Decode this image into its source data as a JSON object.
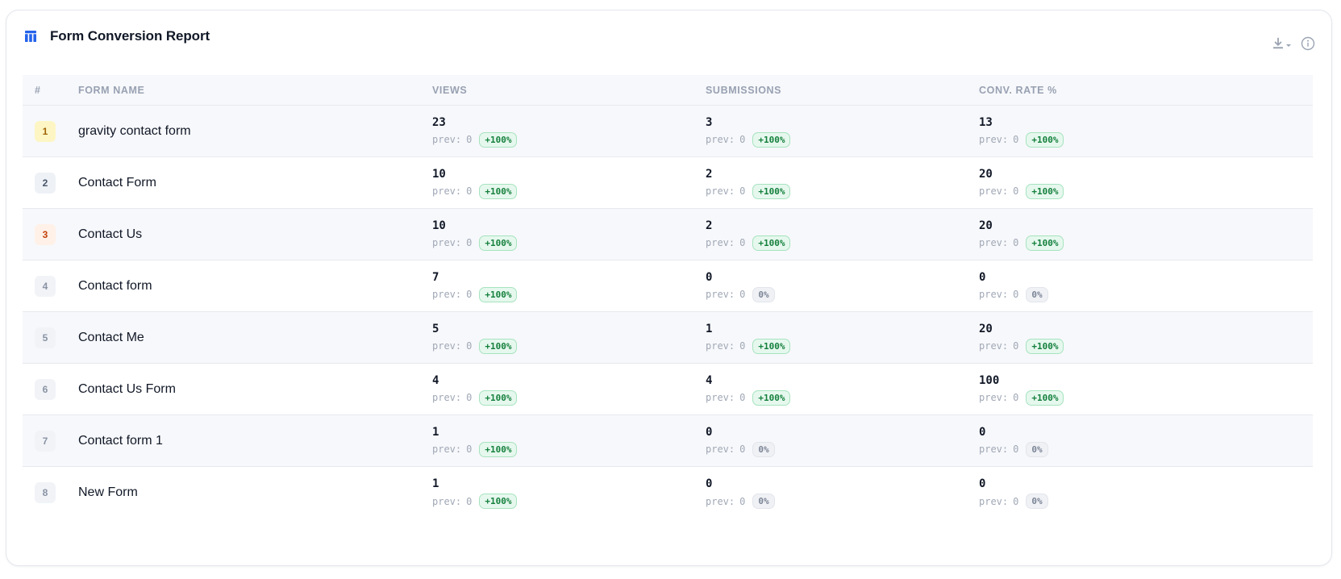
{
  "card": {
    "title": "Form Conversion Report",
    "title_icon": "table-icon",
    "actions": [
      {
        "name": "download-icon"
      },
      {
        "name": "info-icon"
      }
    ]
  },
  "colors": {
    "accent": "#2563eb",
    "positive_badge_bg": "#e6f8ee",
    "positive_badge_text": "#15803d",
    "neutral_badge_bg": "#eff1f5"
  },
  "table": {
    "headers": {
      "rank": "#",
      "name": "FORM NAME",
      "views": "VIEWS",
      "submissions": "SUBMISSIONS",
      "rate": "CONV. RATE %"
    },
    "prev_label": "prev:",
    "rows": [
      {
        "rank": "1",
        "name": "gravity contact form",
        "views": {
          "value": "23",
          "prev": "0",
          "change": "+100%",
          "trend": "positive"
        },
        "submissions": {
          "value": "3",
          "prev": "0",
          "change": "+100%",
          "trend": "positive"
        },
        "rate": {
          "value": "13",
          "prev": "0",
          "change": "+100%",
          "trend": "positive"
        }
      },
      {
        "rank": "2",
        "name": "Contact Form",
        "views": {
          "value": "10",
          "prev": "0",
          "change": "+100%",
          "trend": "positive"
        },
        "submissions": {
          "value": "2",
          "prev": "0",
          "change": "+100%",
          "trend": "positive"
        },
        "rate": {
          "value": "20",
          "prev": "0",
          "change": "+100%",
          "trend": "positive"
        }
      },
      {
        "rank": "3",
        "name": "Contact Us",
        "views": {
          "value": "10",
          "prev": "0",
          "change": "+100%",
          "trend": "positive"
        },
        "submissions": {
          "value": "2",
          "prev": "0",
          "change": "+100%",
          "trend": "positive"
        },
        "rate": {
          "value": "20",
          "prev": "0",
          "change": "+100%",
          "trend": "positive"
        }
      },
      {
        "rank": "4",
        "name": "Contact form",
        "views": {
          "value": "7",
          "prev": "0",
          "change": "+100%",
          "trend": "positive"
        },
        "submissions": {
          "value": "0",
          "prev": "0",
          "change": "0%",
          "trend": "neutral"
        },
        "rate": {
          "value": "0",
          "prev": "0",
          "change": "0%",
          "trend": "neutral"
        }
      },
      {
        "rank": "5",
        "name": "Contact Me",
        "views": {
          "value": "5",
          "prev": "0",
          "change": "+100%",
          "trend": "positive"
        },
        "submissions": {
          "value": "1",
          "prev": "0",
          "change": "+100%",
          "trend": "positive"
        },
        "rate": {
          "value": "20",
          "prev": "0",
          "change": "+100%",
          "trend": "positive"
        }
      },
      {
        "rank": "6",
        "name": "Contact Us Form",
        "views": {
          "value": "4",
          "prev": "0",
          "change": "+100%",
          "trend": "positive"
        },
        "submissions": {
          "value": "4",
          "prev": "0",
          "change": "+100%",
          "trend": "positive"
        },
        "rate": {
          "value": "100",
          "prev": "0",
          "change": "+100%",
          "trend": "positive"
        }
      },
      {
        "rank": "7",
        "name": "Contact form 1",
        "views": {
          "value": "1",
          "prev": "0",
          "change": "+100%",
          "trend": "positive"
        },
        "submissions": {
          "value": "0",
          "prev": "0",
          "change": "0%",
          "trend": "neutral"
        },
        "rate": {
          "value": "0",
          "prev": "0",
          "change": "0%",
          "trend": "neutral"
        }
      },
      {
        "rank": "8",
        "name": "New Form",
        "views": {
          "value": "1",
          "prev": "0",
          "change": "+100%",
          "trend": "positive"
        },
        "submissions": {
          "value": "0",
          "prev": "0",
          "change": "0%",
          "trend": "neutral"
        },
        "rate": {
          "value": "0",
          "prev": "0",
          "change": "0%",
          "trend": "neutral"
        }
      }
    ]
  }
}
